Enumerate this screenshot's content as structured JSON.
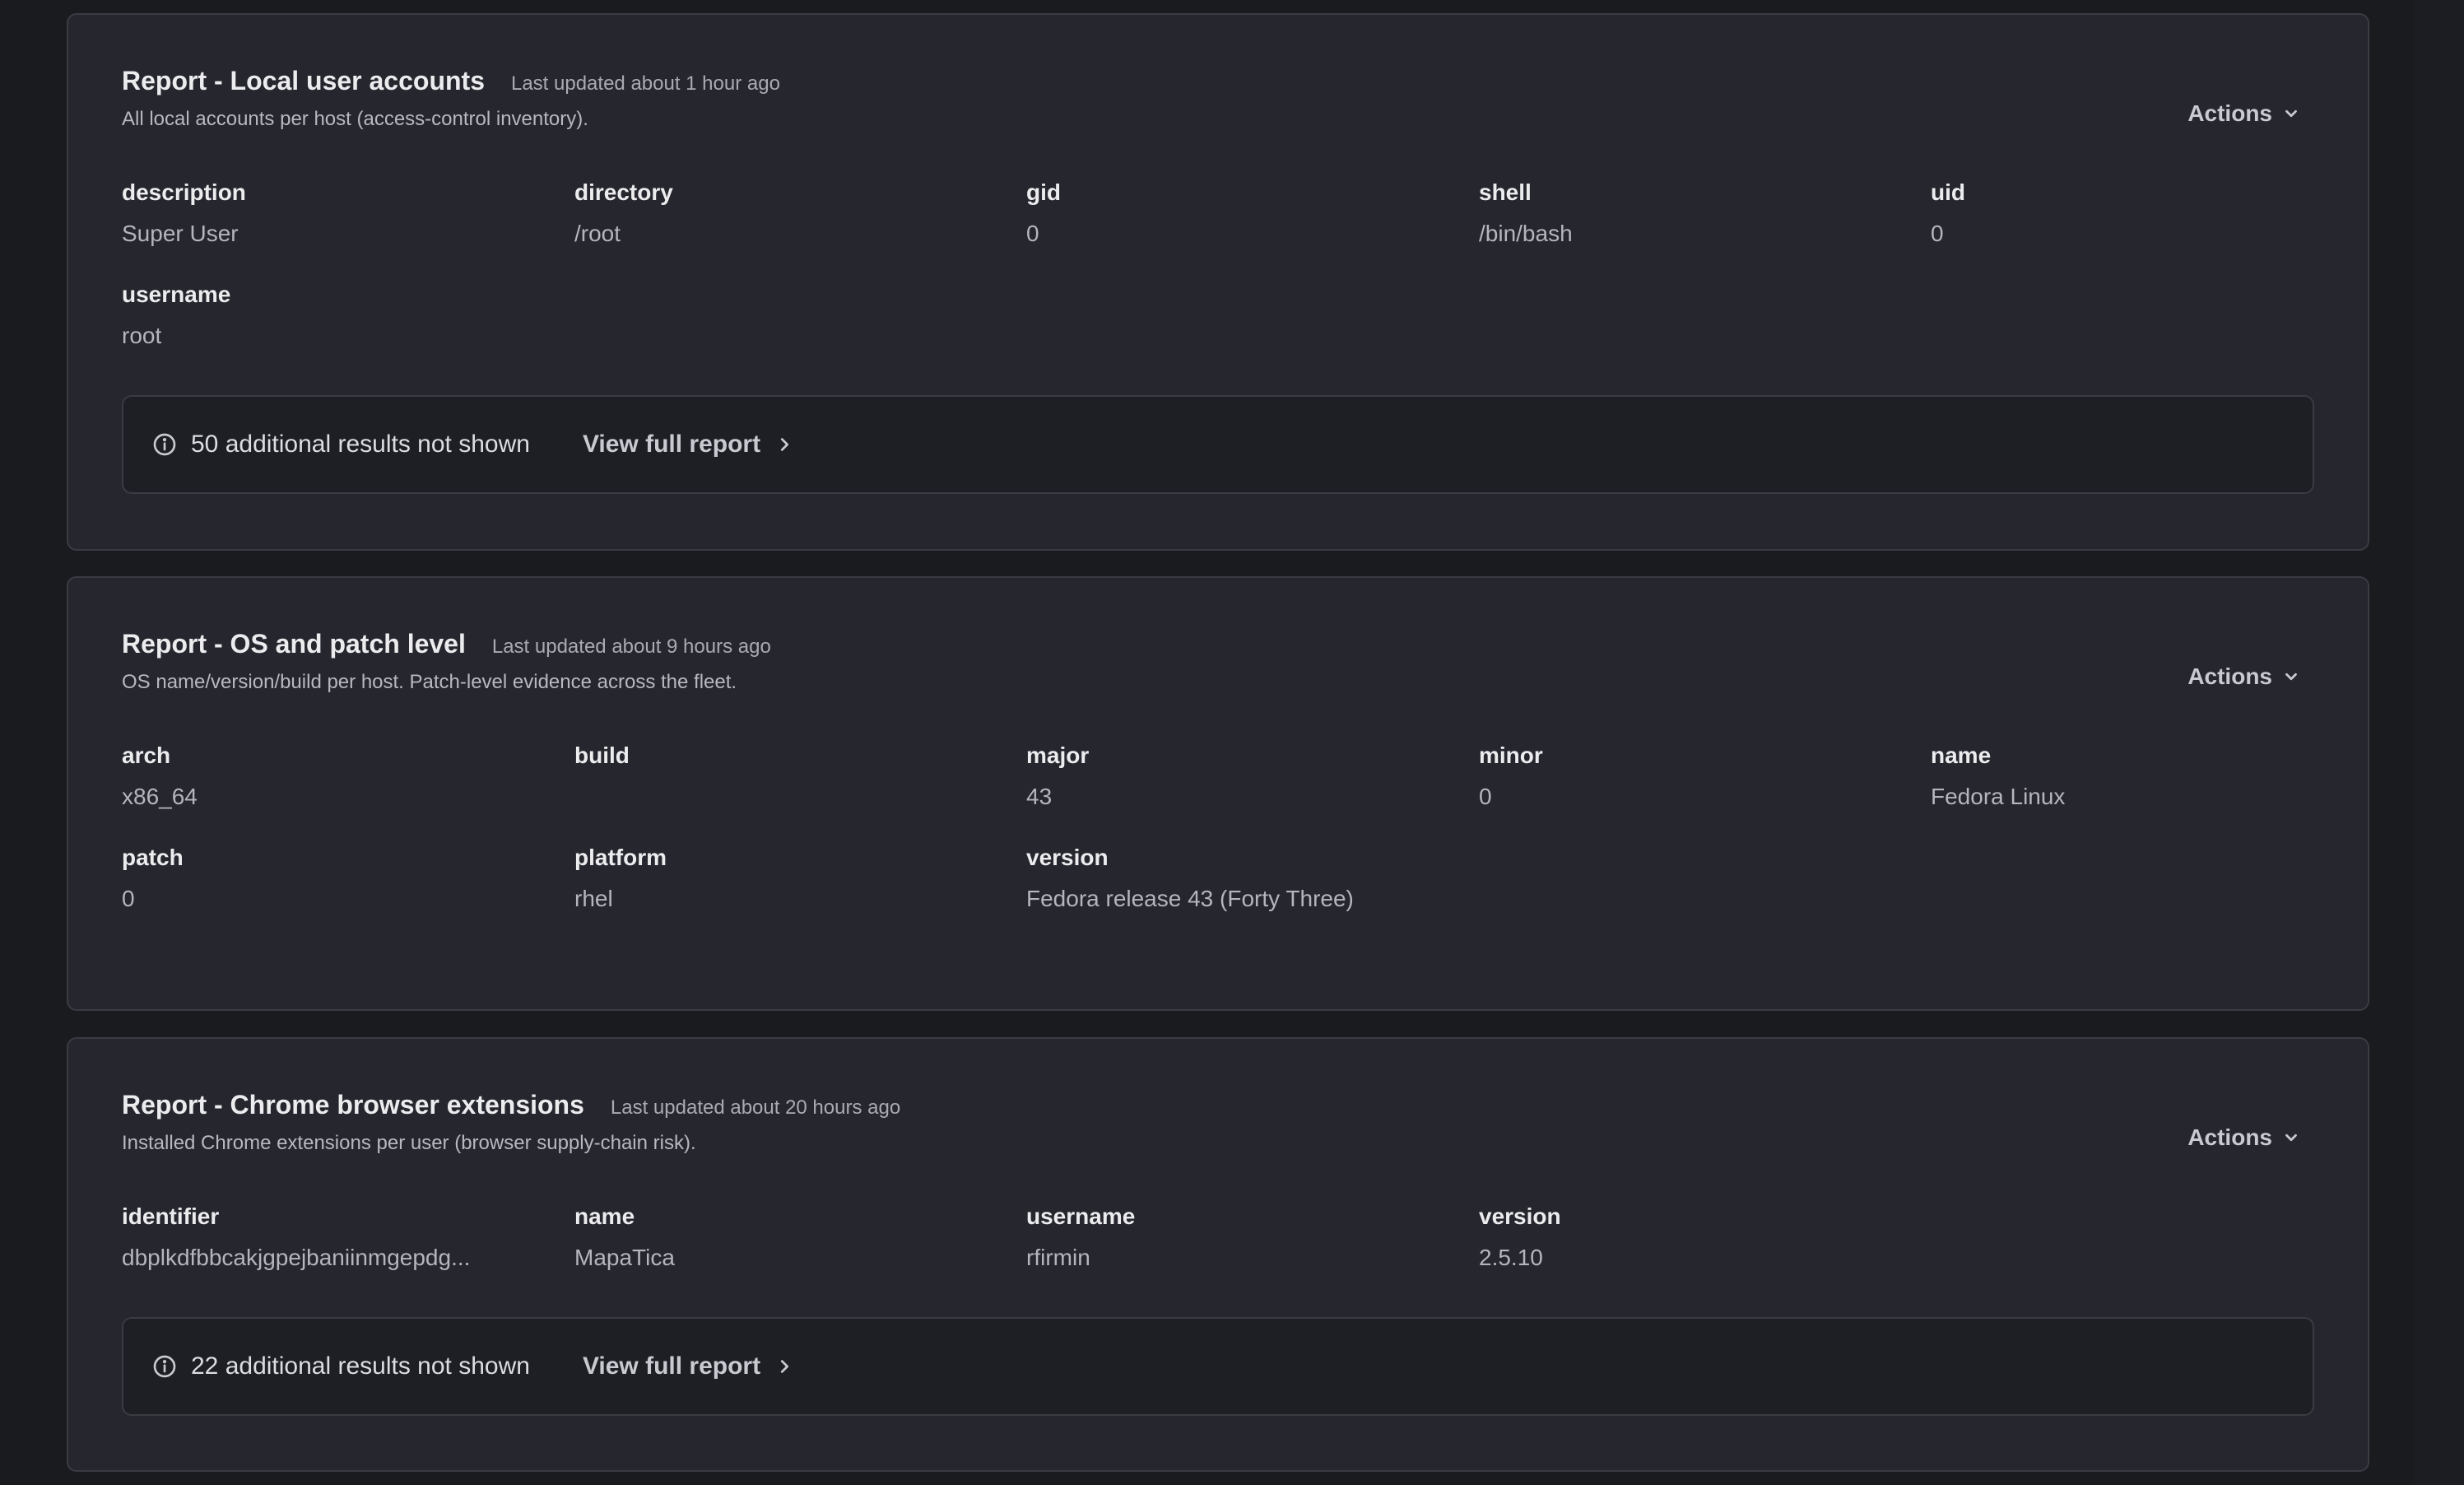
{
  "reports": [
    {
      "title": "Report - Local user accounts",
      "last_updated": "Last updated about 1 hour ago",
      "description": "All local accounts per host (access-control inventory).",
      "actions_label": "Actions",
      "fields": [
        {
          "label": "description",
          "value": "Super User"
        },
        {
          "label": "directory",
          "value": "/root"
        },
        {
          "label": "gid",
          "value": "0"
        },
        {
          "label": "shell",
          "value": "/bin/bash"
        },
        {
          "label": "uid",
          "value": "0"
        },
        {
          "label": "username",
          "value": "root"
        }
      ],
      "notice_text": "50 additional results not shown",
      "view_full_report": "View full report"
    },
    {
      "title": "Report - OS and patch level",
      "last_updated": "Last updated about 9 hours ago",
      "description": "OS name/version/build per host. Patch-level evidence across the fleet.",
      "actions_label": "Actions",
      "fields": [
        {
          "label": "arch",
          "value": "x86_64"
        },
        {
          "label": "build",
          "value": ""
        },
        {
          "label": "major",
          "value": "43"
        },
        {
          "label": "minor",
          "value": "0"
        },
        {
          "label": "name",
          "value": "Fedora Linux"
        },
        {
          "label": "patch",
          "value": "0"
        },
        {
          "label": "platform",
          "value": "rhel"
        },
        {
          "label": "version",
          "value": "Fedora release 43 (Forty Three)"
        }
      ]
    },
    {
      "title": "Report - Chrome browser extensions",
      "last_updated": "Last updated about 20 hours ago",
      "description": "Installed Chrome extensions per user (browser supply-chain risk).",
      "actions_label": "Actions",
      "fields": [
        {
          "label": "identifier",
          "value": "dbplkdfbbcakjgpejbaniinmgepdg..."
        },
        {
          "label": "name",
          "value": "MapaTica"
        },
        {
          "label": "username",
          "value": "rfirmin"
        },
        {
          "label": "version",
          "value": "2.5.10"
        }
      ],
      "notice_text": "22 additional results not shown",
      "view_full_report": "View full report"
    }
  ],
  "icons": {
    "actions": "chevron-down-icon",
    "notice": "info-icon",
    "link": "chevron-right-icon"
  },
  "colors": {
    "background": "#1a1b1f",
    "card": "#26272e",
    "border": "#3a3b43",
    "notice_bg": "#1e1f25"
  }
}
